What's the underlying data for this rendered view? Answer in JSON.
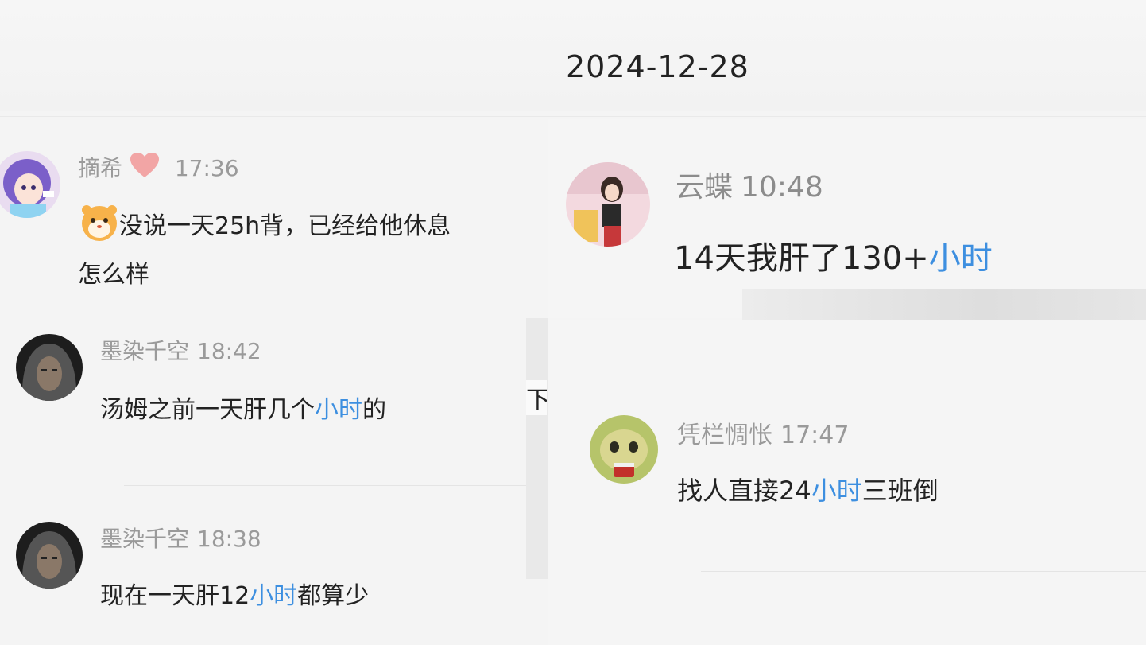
{
  "date_header": "2024-12-28",
  "left_comments": [
    {
      "user": "摘希",
      "time": "17:36",
      "badge": "heart-icon",
      "emoji": "hamster-emoji-icon",
      "text_line1": "没说一天25h背，已经给他休息",
      "text_line2": "怎么样"
    },
    {
      "user": "墨染千空",
      "time": "18:42",
      "before": "汤姆之前一天肝几个",
      "keyword": "小时",
      "after": "的"
    },
    {
      "user": "墨染千空",
      "time": "18:38",
      "before": "现在一天肝12",
      "keyword": "小时",
      "after": "都算少"
    }
  ],
  "right_comments": [
    {
      "user": "云蝶",
      "time": "10:48",
      "before": "14天我肝了130+",
      "keyword": "小时",
      "after": ""
    },
    {
      "user": "凭栏惆怅",
      "time": "17:47",
      "before": "找人直接24",
      "keyword": "小时",
      "after": "三班倒"
    }
  ],
  "partial_char": "下",
  "colors": {
    "keyword": "#3d8fe0",
    "meta": "#9a9a9a",
    "text": "#222222",
    "background": "#f4f4f4"
  }
}
